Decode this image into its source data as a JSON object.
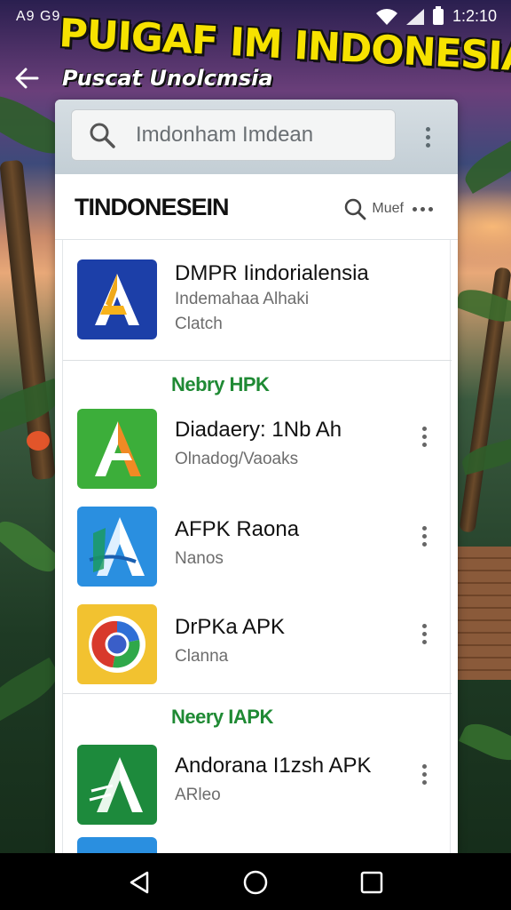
{
  "status_bar": {
    "left_text": "A9 G9",
    "time": "1:2:10"
  },
  "header": {
    "title": "PUIGAF IM INDONESIA",
    "subtitle": "Puscat Unolcmsia"
  },
  "search": {
    "placeholder": "Imdonham Imdean"
  },
  "section": {
    "title": "TINDONESEIN",
    "action_label": "Muef"
  },
  "apps": [
    {
      "name": "DMPR Iindorialensia",
      "sub1": "Indemahaa Alhaki",
      "sub2": "Clatch",
      "icon": "blue-a-logo-icon",
      "color": "#1c3fa8"
    },
    {
      "name": "Diadaery: 1Nb Ah",
      "sub1": "Olnadog/Vaoaks",
      "icon": "green-orange-a-logo-icon",
      "color": "#3cae3a"
    },
    {
      "name": "AFPK Raona",
      "sub1": "Nanos",
      "icon": "blue-white-a-logo-icon",
      "color": "#2a8fe0"
    },
    {
      "name": "DrPKa APK",
      "sub1": "Clanna",
      "icon": "chrome-like-logo-icon",
      "color": "#f2c230"
    },
    {
      "name": "Andorana I1zsh APK",
      "sub1": "ARleo",
      "icon": "green-a-logo-icon",
      "color": "#1d8a3c"
    }
  ],
  "groups": [
    {
      "label": "Nebry HPK"
    },
    {
      "label": "Neery IAPK"
    }
  ],
  "nav": {
    "back": "back-triangle-icon",
    "home": "home-circle-icon",
    "recents": "recents-square-icon"
  }
}
